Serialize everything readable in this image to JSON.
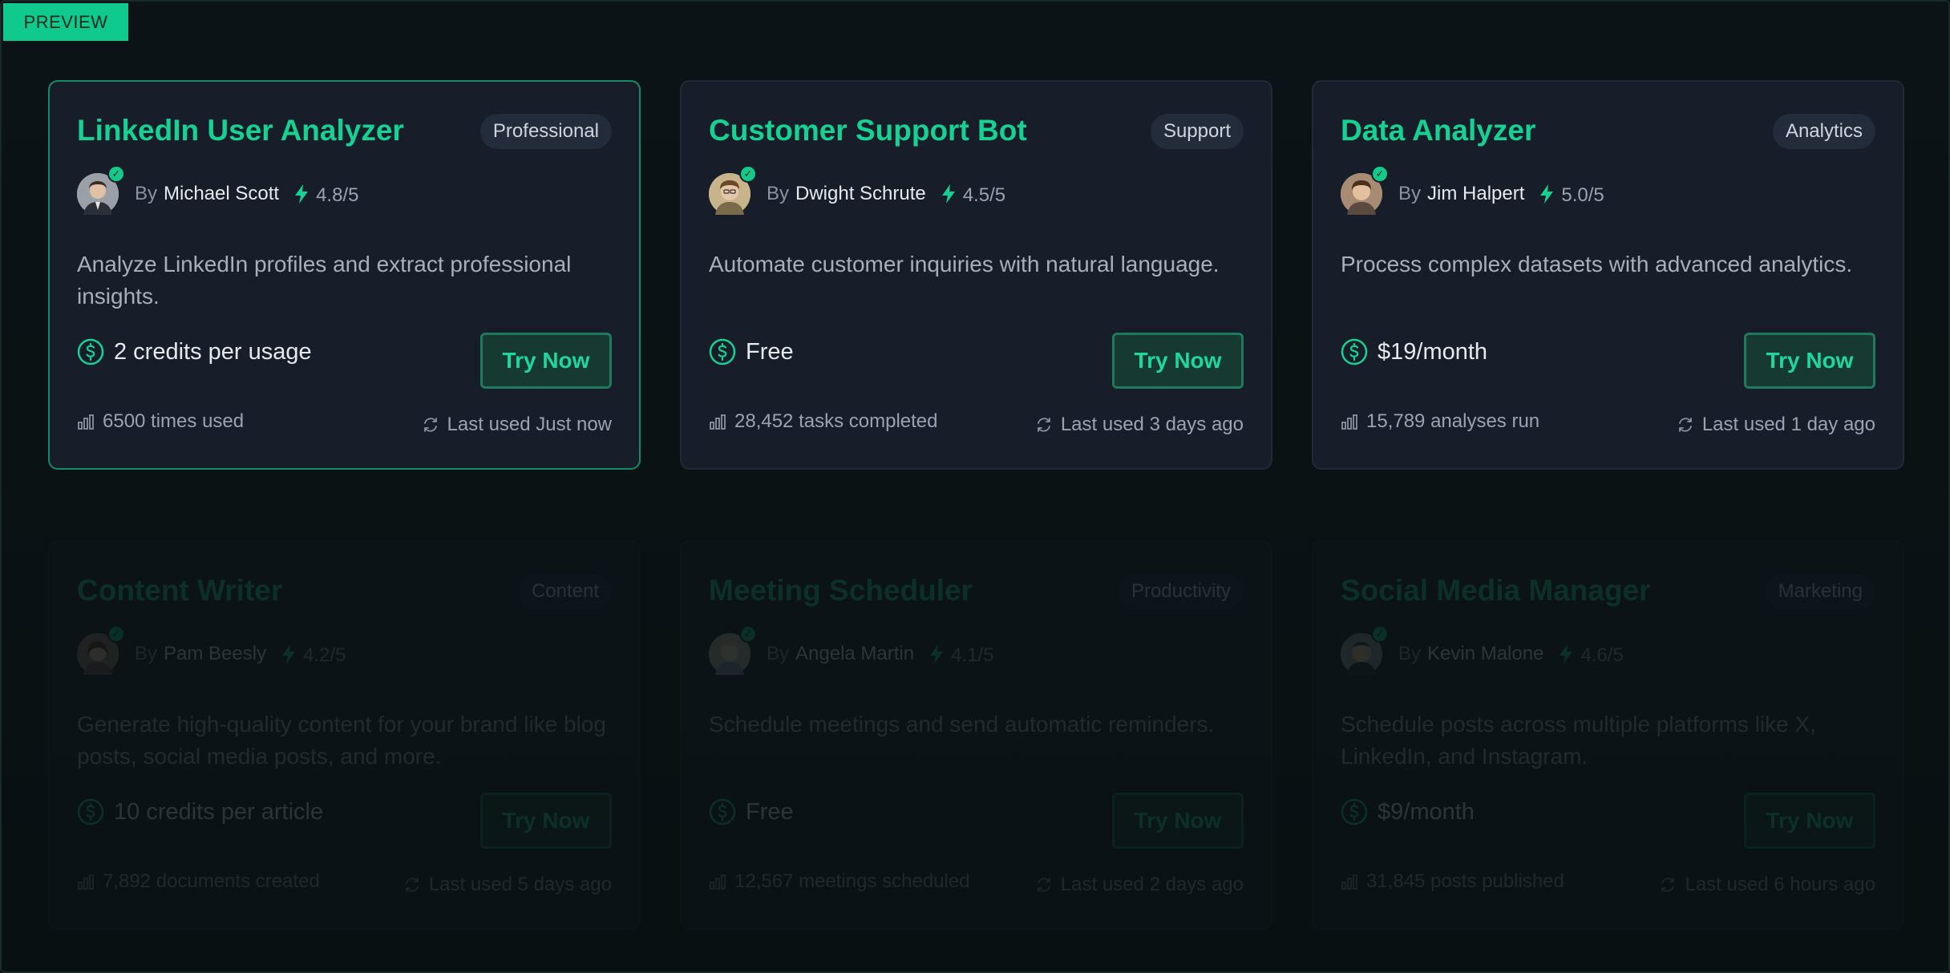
{
  "preview_label": "PREVIEW",
  "colors": {
    "accent": "#17d193",
    "card_bg": "#171e29",
    "page_bg": "#0a0f12"
  },
  "cards": [
    {
      "title": "LinkedIn User Analyzer",
      "category": "Professional",
      "by": "By",
      "author": "Michael Scott",
      "rating": "4.8/5",
      "description": "Analyze LinkedIn profiles and extract professional insights.",
      "price": "2 credits per usage",
      "button": "Try Now",
      "usage": "6500 times used",
      "last_used": "Last used Just now",
      "selected": true,
      "faded": false
    },
    {
      "title": "Customer Support Bot",
      "category": "Support",
      "by": "By",
      "author": "Dwight Schrute",
      "rating": "4.5/5",
      "description": "Automate customer inquiries with natural language.",
      "price": "Free",
      "button": "Try Now",
      "usage": "28,452 tasks completed",
      "last_used": "Last used 3 days ago",
      "selected": false,
      "faded": false
    },
    {
      "title": "Data Analyzer",
      "category": "Analytics",
      "by": "By",
      "author": "Jim Halpert",
      "rating": "5.0/5",
      "description": "Process complex datasets with advanced analytics.",
      "price": "$19/month",
      "button": "Try Now",
      "usage": "15,789 analyses run",
      "last_used": "Last used 1 day ago",
      "selected": false,
      "faded": false
    },
    {
      "title": "Content Writer",
      "category": "Content",
      "by": "By",
      "author": "Pam Beesly",
      "rating": "4.2/5",
      "description": "Generate high-quality content for your brand like blog posts, social media posts, and more.",
      "price": "10 credits per article",
      "button": "Try Now",
      "usage": "7,892 documents created",
      "last_used": "Last used 5 days ago",
      "selected": false,
      "faded": true
    },
    {
      "title": "Meeting Scheduler",
      "category": "Productivity",
      "by": "By",
      "author": "Angela Martin",
      "rating": "4.1/5",
      "description": "Schedule meetings and send automatic reminders.",
      "price": "Free",
      "button": "Try Now",
      "usage": "12,567 meetings scheduled",
      "last_used": "Last used 2 days ago",
      "selected": false,
      "faded": true
    },
    {
      "title": "Social Media Manager",
      "category": "Marketing",
      "by": "By",
      "author": "Kevin Malone",
      "rating": "4.6/5",
      "description": "Schedule posts across multiple platforms like X, LinkedIn, and Instagram.",
      "price": "$9/month",
      "button": "Try Now",
      "usage": "31,845 posts published",
      "last_used": "Last used 6 hours ago",
      "selected": false,
      "faded": true
    }
  ]
}
